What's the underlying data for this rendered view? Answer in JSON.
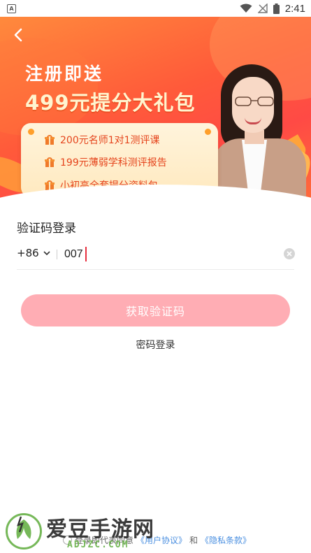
{
  "status_bar": {
    "app_badge": "A",
    "time": "2:41"
  },
  "banner": {
    "title_line1": "注册即送",
    "title_line2": "499元提分大礼包",
    "items": [
      "200元名师1对1测评课",
      "199元薄弱学科测评报告",
      "小初高全套提分资料包"
    ]
  },
  "login": {
    "title": "验证码登录",
    "country_code": "+86",
    "phone_value": "007",
    "get_code_label": "获取验证码",
    "password_login_label": "密码登录"
  },
  "agreement": {
    "prefix": "登录即代表同意",
    "user_agreement": "《用户协议》",
    "and": "和",
    "privacy": "《隐私条款》"
  },
  "watermark": {
    "name": "爱豆手游网",
    "domain": "ADJZC.COM"
  },
  "colors": {
    "banner_red": "#ff4a45",
    "banner_orange": "#ff8a3c",
    "button_pink": "#ffadb4",
    "link_blue": "#4a8fe0",
    "caret_red": "#e8303f"
  },
  "icons": {
    "back": "chevron-left-icon",
    "gift": "gift-icon",
    "clear": "clear-circle-icon",
    "dropdown": "chevron-down-icon"
  }
}
